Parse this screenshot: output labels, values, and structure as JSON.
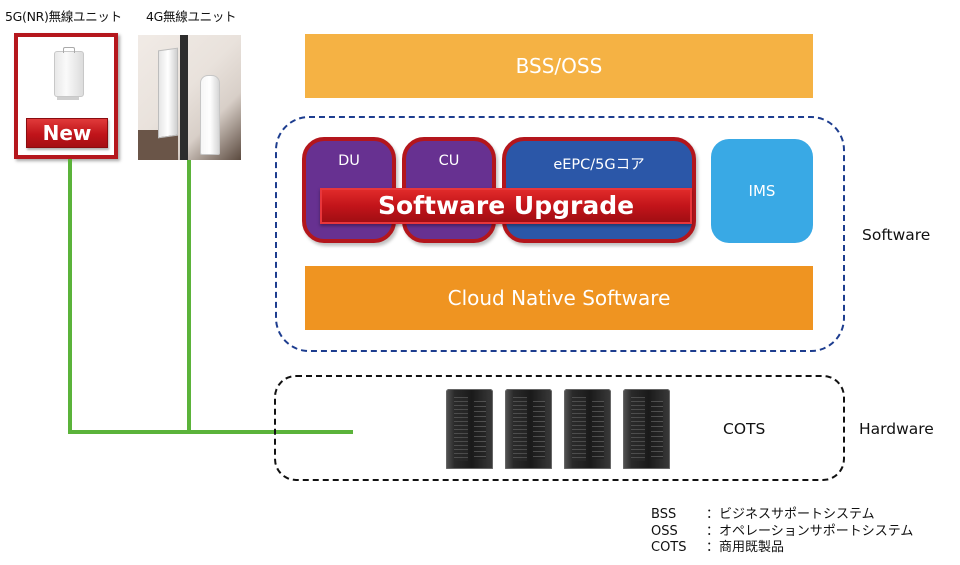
{
  "radio_units": {
    "unit_5g": {
      "label": "5G(NR)無線ユニット",
      "badge": "New"
    },
    "unit_4g": {
      "label": "4G無線ユニット"
    }
  },
  "layers": {
    "bss_oss": "BSS/OSS",
    "software": {
      "label": "Software",
      "blocks": [
        {
          "label": "DU"
        },
        {
          "label": "CU"
        },
        {
          "label": "eEPC/5Gコア"
        },
        {
          "label": "IMS"
        }
      ],
      "upgrade_banner": "Software Upgrade",
      "cloud_native": "Cloud Native Software"
    },
    "hardware": {
      "label": "Hardware",
      "cots": "COTS",
      "server_count": 4
    }
  },
  "legend": [
    {
      "abbr": "BSS",
      "desc": "：ビジネスサポートシステム"
    },
    {
      "abbr": "OSS",
      "desc": "：オペレーションサポートシステム"
    },
    {
      "abbr": "COTS",
      "desc": "：商用既製品"
    }
  ],
  "colors": {
    "bss_oss": "#f5b244",
    "cloud_native": "#ef9421",
    "du_cu": "#673191",
    "epc": "#2b57a8",
    "ims": "#39a9e5",
    "upgrade_red": "#c2141a",
    "connection_green": "#5bb33a",
    "software_border": "#1d3d8f"
  }
}
